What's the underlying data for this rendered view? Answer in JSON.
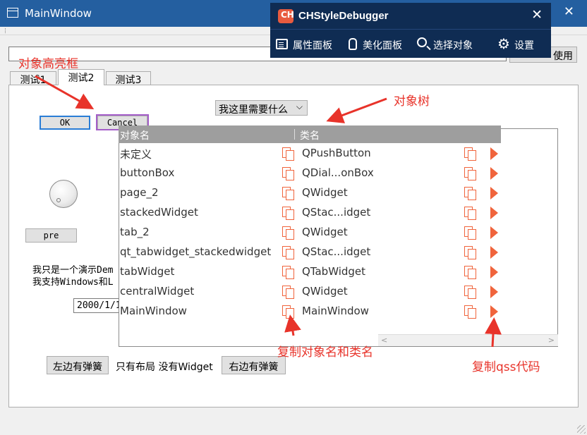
{
  "window": {
    "title": "MainWindow",
    "close_glyph": "✕"
  },
  "toolbar": {
    "use_button_label": "使用",
    "use_button_arrow": "▼"
  },
  "tabs": [
    {
      "label": "测试1"
    },
    {
      "label": "测试2"
    },
    {
      "label": "测试3"
    }
  ],
  "page": {
    "ok_label": "OK",
    "cancel_label": "Cancel",
    "combo_value": "我这里需要什么",
    "pre_label": "pre",
    "demo_line1": "我只是一个演示Dem",
    "demo_line2": "我支持Windows和L",
    "date_value": "2000/1/1",
    "left_spring_label": "左边有弹簧",
    "center_label": "只有布局 没有Widget",
    "right_spring_label": "右边有弹簧"
  },
  "debugger": {
    "logo_text": "CH",
    "title": "CHStyleDebugger",
    "close_glyph": "✕",
    "tools": [
      {
        "label": "属性面板",
        "icon": "panel-icon"
      },
      {
        "label": "美化面板",
        "icon": "clipboard-icon"
      },
      {
        "label": "选择对象",
        "icon": "search-icon"
      },
      {
        "label": "设置",
        "icon": "gear-icon"
      }
    ]
  },
  "tree": {
    "headers": {
      "name": "对象名",
      "class": "类名"
    },
    "rows": [
      {
        "name": "未定义",
        "class": "QPushButton"
      },
      {
        "name": "buttonBox",
        "class": "QDial...onBox"
      },
      {
        "name": "page_2",
        "class": "QWidget"
      },
      {
        "name": "stackedWidget",
        "class": "QStac...idget"
      },
      {
        "name": "tab_2",
        "class": "QWidget"
      },
      {
        "name": "qt_tabwidget_stackedwidget",
        "class": "QStac...idget"
      },
      {
        "name": "tabWidget",
        "class": "QTabWidget"
      },
      {
        "name": "centralWidget",
        "class": "QWidget"
      },
      {
        "name": "MainWindow",
        "class": "MainWindow"
      }
    ],
    "scroll_left_glyph": "<",
    "scroll_right_glyph": ">"
  },
  "annotations": {
    "highlight_box": "对象高亮框",
    "object_tree": "对象树",
    "copy_name_class": "复制对象名和类名",
    "copy_qss": "复制qss代码"
  },
  "colors": {
    "titlebar": "#245fa0",
    "debugger_bg": "#0f2c53",
    "accent_orange": "#f0643c",
    "annotation_red": "#e8332a",
    "highlight_purple": "#a45ec9"
  }
}
